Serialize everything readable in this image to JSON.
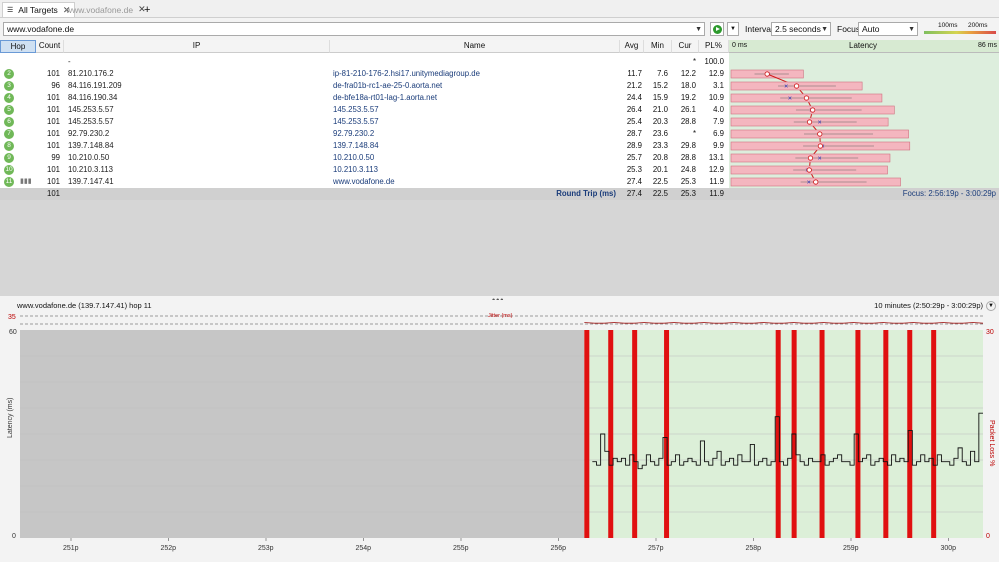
{
  "tabs": [
    {
      "label": "All Targets",
      "active": true
    },
    {
      "label": "www.vodafone.de",
      "active": false
    }
  ],
  "toolbar": {
    "target_value": "www.vodafone.de",
    "interval_label": "Interval",
    "interval_value": "2.5 seconds",
    "focus_label": "Focus",
    "focus_value": "Auto",
    "legend_100": "100ms",
    "legend_200": "200ms"
  },
  "table": {
    "headers": {
      "hop": "Hop",
      "count": "Count",
      "ip": "IP",
      "name": "Name",
      "avg": "Avg",
      "min": "Min",
      "cur": "Cur",
      "pl": "PL%"
    },
    "rows": [
      {
        "hop": "",
        "count": "",
        "ip": "-",
        "name": "",
        "avg": "",
        "min": "",
        "cur": "*",
        "pl": "100.0"
      },
      {
        "hop": "2",
        "count": "101",
        "ip": "81.210.176.2",
        "name": "ip-81-210-176-2.hsi17.unitymediagroup.de",
        "avg": "11.7",
        "min": "7.6",
        "cur": "12.2",
        "pl": "12.9"
      },
      {
        "hop": "3",
        "count": "96",
        "ip": "84.116.191.209",
        "name": "de-fra01b-rc1-ae-25-0.aorta.net",
        "avg": "21.2",
        "min": "15.2",
        "cur": "18.0",
        "pl": "3.1"
      },
      {
        "hop": "4",
        "count": "101",
        "ip": "84.116.190.34",
        "name": "de-bfe18a-rt01-lag-1.aorta.net",
        "avg": "24.4",
        "min": "15.9",
        "cur": "19.2",
        "pl": "10.9"
      },
      {
        "hop": "5",
        "count": "101",
        "ip": "145.253.5.57",
        "name": "145.253.5.57",
        "avg": "26.4",
        "min": "21.0",
        "cur": "26.1",
        "pl": "4.0"
      },
      {
        "hop": "6",
        "count": "101",
        "ip": "145.253.5.57",
        "name": "145.253.5.57",
        "avg": "25.4",
        "min": "20.3",
        "cur": "28.8",
        "pl": "7.9"
      },
      {
        "hop": "7",
        "count": "101",
        "ip": "92.79.230.2",
        "name": "92.79.230.2",
        "avg": "28.7",
        "min": "23.6",
        "cur": "*",
        "pl": "6.9"
      },
      {
        "hop": "8",
        "count": "101",
        "ip": "139.7.148.84",
        "name": "139.7.148.84",
        "avg": "28.9",
        "min": "23.3",
        "cur": "29.8",
        "pl": "9.9"
      },
      {
        "hop": "9",
        "count": "99",
        "ip": "10.210.0.50",
        "name": "10.210.0.50",
        "avg": "25.7",
        "min": "20.8",
        "cur": "28.8",
        "pl": "13.1"
      },
      {
        "hop": "10",
        "count": "101",
        "ip": "10.210.3.113",
        "name": "10.210.3.113",
        "avg": "25.3",
        "min": "20.1",
        "cur": "24.8",
        "pl": "12.9"
      },
      {
        "hop": "11",
        "count": "101",
        "ip": "139.7.147.41",
        "name": "www.vodafone.de",
        "avg": "27.4",
        "min": "22.5",
        "cur": "25.3",
        "pl": "11.9"
      }
    ],
    "summary": {
      "count": "101",
      "label": "Round Trip (ms)",
      "avg": "27.4",
      "min": "22.5",
      "cur": "25.3",
      "pl": "11.9",
      "focus": "Focus: 2:56:19p - 3:00:29p"
    }
  },
  "latency_panel": {
    "title": "Latency",
    "min_label": "0 ms",
    "max_label": "86 ms",
    "max_ms": 86
  },
  "graph": {
    "target_label": "www.vodafone.de (139.7.147.41) hop 11",
    "range_label": "10 minutes (2:50:29p - 3:00:29p)",
    "jitter_label": "Jitter (ms)",
    "jitter_max": "35",
    "y_left_label": "Latency (ms)",
    "y_right_label": "Packet Loss %",
    "y_left_max": "60",
    "y_left_min": "0",
    "y_right_max": "30",
    "y_right_min": "0",
    "x_ticks": [
      "251p",
      "252p",
      "253p",
      "254p",
      "255p",
      "256p",
      "257p",
      "258p",
      "259p",
      "300p"
    ]
  },
  "chart_data": {
    "type": "line",
    "title": "",
    "xlabel": "",
    "ylabel": "Latency (ms)",
    "ylim": [
      0,
      60
    ],
    "y2label": "Packet Loss %",
    "y2lim": [
      0,
      30
    ],
    "x_ticks": [
      "251p",
      "252p",
      "253p",
      "254p",
      "255p",
      "256p",
      "257p",
      "258p",
      "259p",
      "300p"
    ],
    "series": [
      {
        "values": [
          22,
          21,
          30,
          25,
          21,
          23,
          22,
          23,
          21,
          24,
          22,
          20,
          21,
          24,
          22,
          21,
          23,
          29,
          21,
          22,
          24,
          21,
          22,
          23,
          22,
          21,
          28,
          22,
          21,
          23,
          25,
          21,
          22,
          23,
          21,
          24,
          22,
          22,
          27,
          21,
          22,
          23,
          21,
          22,
          35,
          22,
          21,
          23,
          30,
          24,
          22,
          21,
          23,
          22,
          22,
          24,
          21,
          22,
          23,
          24,
          22,
          22,
          21,
          30,
          22,
          23,
          24,
          21,
          22,
          23,
          22,
          21,
          24,
          22,
          23,
          22,
          31,
          21,
          22,
          24,
          22,
          23,
          21,
          24,
          22,
          22,
          21,
          23,
          26,
          22,
          21,
          25,
          22,
          36
        ]
      }
    ],
    "loss_bars": [
      0.0,
      0.06,
      0.12,
      0.2,
      0.48,
      0.52,
      0.59,
      0.68,
      0.75,
      0.81,
      0.87
    ]
  }
}
